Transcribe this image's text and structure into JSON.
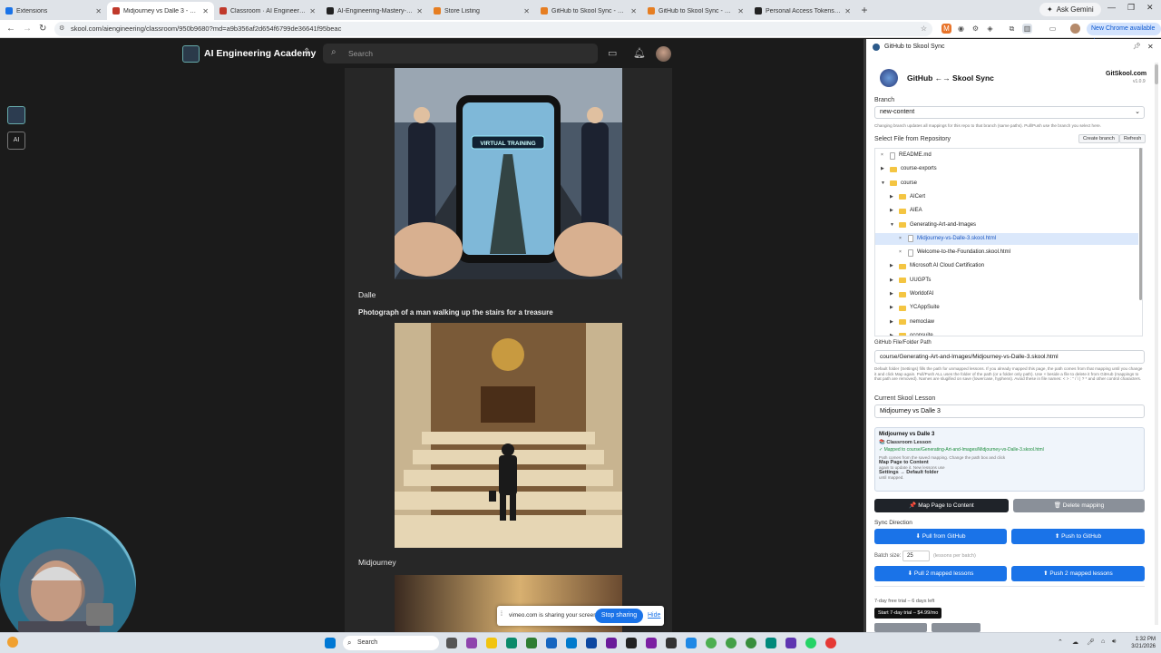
{
  "browser": {
    "tabs": [
      {
        "title": "Extensions",
        "color": "#1a73e8"
      },
      {
        "title": "Midjourney vs Dalle 3 - Generati",
        "color": "#c0392b",
        "active": true
      },
      {
        "title": "Classroom · AI Engineering (Fre",
        "color": "#c0392b"
      },
      {
        "title": "AI-Engineering-Mastery-Course",
        "color": "#222"
      },
      {
        "title": "Store Listing",
        "color": "#e67e22"
      },
      {
        "title": "GitHub to Skool Sync - Chrome",
        "color": "#e67e22"
      },
      {
        "title": "GitHub to Skool Sync - Chrome",
        "color": "#e67e22"
      },
      {
        "title": "Personal Access Tokens (Classi",
        "color": "#222"
      }
    ],
    "ask_gemini": "Ask Gemini",
    "url": "skool.com/aiengineering/classroom/950b9680?md=a9b356af2d654f6799de36641f95beac",
    "update_chip": "New Chrome available"
  },
  "skool": {
    "brand": "AI Engineering Academy",
    "search_placeholder": "Search",
    "label_dalle": "Dalle",
    "prompt": "Photograph of a man walking up the stairs for a treasure",
    "label_midjourney": "Midjourney",
    "image1_text": "VIRTUAL TRAINING"
  },
  "sharing": {
    "text": "vimeo.com is sharing your screen.",
    "stop": "Stop sharing",
    "hide": "Hide"
  },
  "panel": {
    "window_title": "GitHub to Skool Sync",
    "app_title": "GitHub ←→ Skool Sync",
    "site": "GitSkool.com",
    "version": "v1.0.9",
    "branch_label": "Branch",
    "branch_value": "new-content",
    "branch_hint": "Changing branch updates all mappings for this repo to that branch (same paths). Pull/Push use the branch you select here.",
    "select_file_label": "Select File from Repository",
    "create_branch": "Create branch",
    "refresh": "Refresh",
    "tree": [
      {
        "name": "README.md",
        "depth": 0,
        "type": "file",
        "toggle": "×"
      },
      {
        "name": "course-exports",
        "depth": 0,
        "type": "folder",
        "toggle": "▶"
      },
      {
        "name": "course",
        "depth": 0,
        "type": "folder",
        "toggle": "▼"
      },
      {
        "name": "AICert",
        "depth": 1,
        "type": "folder",
        "toggle": "▶"
      },
      {
        "name": "AIEA",
        "depth": 1,
        "type": "folder",
        "toggle": "▶"
      },
      {
        "name": "Generating-Art-and-Images",
        "depth": 1,
        "type": "folder",
        "toggle": "▼"
      },
      {
        "name": "Midjourney-vs-Dalle-3.skool.html",
        "depth": 2,
        "type": "file",
        "toggle": "×",
        "selected": true
      },
      {
        "name": "Welcome-to-the-Foundation.skool.html",
        "depth": 2,
        "type": "file",
        "toggle": "×"
      },
      {
        "name": "Microsoft AI Cloud Certification",
        "depth": 1,
        "type": "folder",
        "toggle": "▶"
      },
      {
        "name": "UUGPTs",
        "depth": 1,
        "type": "folder",
        "toggle": "▶"
      },
      {
        "name": "WorldofAI",
        "depth": 1,
        "type": "folder",
        "toggle": "▶"
      },
      {
        "name": "YCAppSuite",
        "depth": 1,
        "type": "folder",
        "toggle": "▶"
      },
      {
        "name": "nemoclaw",
        "depth": 1,
        "type": "folder",
        "toggle": "▶"
      },
      {
        "name": "oconsuite",
        "depth": 1,
        "type": "folder",
        "toggle": "▶"
      }
    ],
    "path_label": "GitHub File/Folder Path",
    "path_value": "course/Generating-Art-and-Images/Midjourney-vs-Dalle-3.skool.html",
    "path_hint": "Default folder (Settings) fills the path for unmapped lessons. If you already mapped this page, the path comes from that mapping until you change it and click Map again. Pull/Push ALL uses the folder of the path (or a folder only path). Use × beside a file to delete it from GitHub (mappings to that path are removed). Names are slugified on save (lowercase, hyphens). Avoid these in file names: < > : \" / \\ | ? * and other control characters.",
    "lesson_label": "Current Skool Lesson",
    "lesson_value": "Midjourney vs Dalle 3",
    "status_title": "Midjourney vs Dalle 3",
    "status_type": "Classroom Lesson",
    "status_mapped": "✓ Mapped to course/Generating-Art-and-Images/Midjourney-vs-Dalle-3.skool.html",
    "status_note1": "Path comes from the saved mapping. Change the path box and click",
    "status_bold1": "Map Page to Content",
    "status_note2": "again to update it. New lessons use",
    "status_bold2": "Settings → Default folder",
    "status_note3": "until mapped.",
    "map_btn": "📌 Map Page to Content",
    "delete_btn": "🗑 Delete mapping",
    "sync_label": "Sync Direction",
    "pull_btn": "⬇ Pull from GitHub",
    "push_btn": "⬆ Push to GitHub",
    "batch_label": "Batch size:",
    "batch_value": "25",
    "batch_hint": "(lessons per batch)",
    "pull_all": "⬇ Pull 2 mapped lessons",
    "push_all": "⬆ Push 2 mapped lessons",
    "trial_text": "7-day free trial – 6 days left",
    "trial_btn": "Start 7-day trial – $4.99/mo",
    "colors": {
      "primary": "#1a73e8",
      "dark": "#1f2329",
      "gray": "#8a9099"
    }
  },
  "taskbar": {
    "search": "Search",
    "time": "1:32 PM",
    "date": "3/21/2026"
  }
}
